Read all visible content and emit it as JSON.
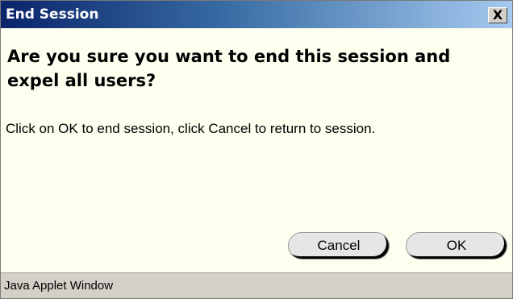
{
  "window": {
    "title": "End Session",
    "close_label": "X"
  },
  "dialog": {
    "heading": "Are you sure you want to end this session and expel all users?",
    "message": "Click on OK to end session, click Cancel to return to session."
  },
  "buttons": {
    "cancel_label": "Cancel",
    "ok_label": "OK"
  },
  "statusbar": {
    "text": "Java Applet Window"
  },
  "colors": {
    "titlebar_start": "#0a246a",
    "titlebar_end": "#a6caf0",
    "content_background": "#fffff0",
    "statusbar_background": "#d4d0c8"
  }
}
